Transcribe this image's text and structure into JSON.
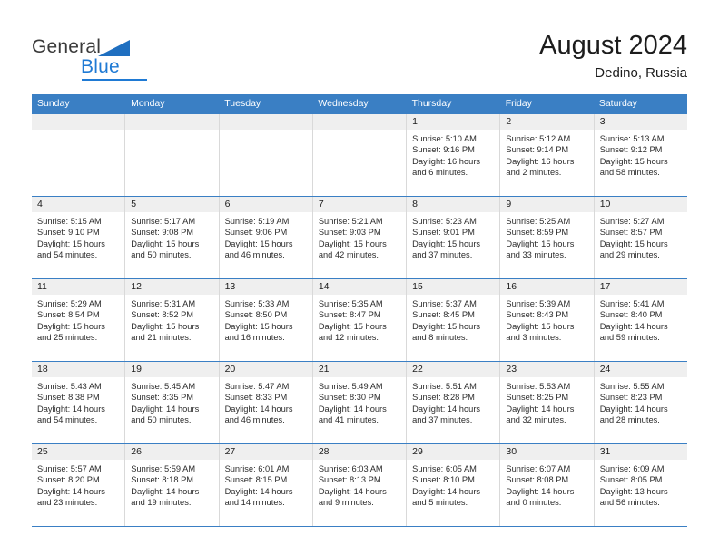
{
  "brand": {
    "name_part1": "General",
    "name_part2": "Blue",
    "triangle_icon": "triangle-icon",
    "colors": {
      "general_text": "#3a3a3a",
      "blue_text": "#1f7ad4",
      "triangle": "#1f6fc0"
    }
  },
  "header": {
    "month_year": "August 2024",
    "location": "Dedino, Russia"
  },
  "calendar": {
    "accent_color": "#3a7fc4",
    "band_color": "#efefef",
    "weekdays": [
      "Sunday",
      "Monday",
      "Tuesday",
      "Wednesday",
      "Thursday",
      "Friday",
      "Saturday"
    ],
    "weeks": [
      [
        {
          "day": "",
          "empty": true,
          "sunrise": "",
          "sunset": "",
          "daylight_line1": "",
          "daylight_line2": ""
        },
        {
          "day": "",
          "empty": true,
          "sunrise": "",
          "sunset": "",
          "daylight_line1": "",
          "daylight_line2": ""
        },
        {
          "day": "",
          "empty": true,
          "sunrise": "",
          "sunset": "",
          "daylight_line1": "",
          "daylight_line2": ""
        },
        {
          "day": "",
          "empty": true,
          "sunrise": "",
          "sunset": "",
          "daylight_line1": "",
          "daylight_line2": ""
        },
        {
          "day": "1",
          "empty": false,
          "sunrise": "Sunrise: 5:10 AM",
          "sunset": "Sunset: 9:16 PM",
          "daylight_line1": "Daylight: 16 hours",
          "daylight_line2": "and 6 minutes."
        },
        {
          "day": "2",
          "empty": false,
          "sunrise": "Sunrise: 5:12 AM",
          "sunset": "Sunset: 9:14 PM",
          "daylight_line1": "Daylight: 16 hours",
          "daylight_line2": "and 2 minutes."
        },
        {
          "day": "3",
          "empty": false,
          "sunrise": "Sunrise: 5:13 AM",
          "sunset": "Sunset: 9:12 PM",
          "daylight_line1": "Daylight: 15 hours",
          "daylight_line2": "and 58 minutes."
        }
      ],
      [
        {
          "day": "4",
          "empty": false,
          "sunrise": "Sunrise: 5:15 AM",
          "sunset": "Sunset: 9:10 PM",
          "daylight_line1": "Daylight: 15 hours",
          "daylight_line2": "and 54 minutes."
        },
        {
          "day": "5",
          "empty": false,
          "sunrise": "Sunrise: 5:17 AM",
          "sunset": "Sunset: 9:08 PM",
          "daylight_line1": "Daylight: 15 hours",
          "daylight_line2": "and 50 minutes."
        },
        {
          "day": "6",
          "empty": false,
          "sunrise": "Sunrise: 5:19 AM",
          "sunset": "Sunset: 9:06 PM",
          "daylight_line1": "Daylight: 15 hours",
          "daylight_line2": "and 46 minutes."
        },
        {
          "day": "7",
          "empty": false,
          "sunrise": "Sunrise: 5:21 AM",
          "sunset": "Sunset: 9:03 PM",
          "daylight_line1": "Daylight: 15 hours",
          "daylight_line2": "and 42 minutes."
        },
        {
          "day": "8",
          "empty": false,
          "sunrise": "Sunrise: 5:23 AM",
          "sunset": "Sunset: 9:01 PM",
          "daylight_line1": "Daylight: 15 hours",
          "daylight_line2": "and 37 minutes."
        },
        {
          "day": "9",
          "empty": false,
          "sunrise": "Sunrise: 5:25 AM",
          "sunset": "Sunset: 8:59 PM",
          "daylight_line1": "Daylight: 15 hours",
          "daylight_line2": "and 33 minutes."
        },
        {
          "day": "10",
          "empty": false,
          "sunrise": "Sunrise: 5:27 AM",
          "sunset": "Sunset: 8:57 PM",
          "daylight_line1": "Daylight: 15 hours",
          "daylight_line2": "and 29 minutes."
        }
      ],
      [
        {
          "day": "11",
          "empty": false,
          "sunrise": "Sunrise: 5:29 AM",
          "sunset": "Sunset: 8:54 PM",
          "daylight_line1": "Daylight: 15 hours",
          "daylight_line2": "and 25 minutes."
        },
        {
          "day": "12",
          "empty": false,
          "sunrise": "Sunrise: 5:31 AM",
          "sunset": "Sunset: 8:52 PM",
          "daylight_line1": "Daylight: 15 hours",
          "daylight_line2": "and 21 minutes."
        },
        {
          "day": "13",
          "empty": false,
          "sunrise": "Sunrise: 5:33 AM",
          "sunset": "Sunset: 8:50 PM",
          "daylight_line1": "Daylight: 15 hours",
          "daylight_line2": "and 16 minutes."
        },
        {
          "day": "14",
          "empty": false,
          "sunrise": "Sunrise: 5:35 AM",
          "sunset": "Sunset: 8:47 PM",
          "daylight_line1": "Daylight: 15 hours",
          "daylight_line2": "and 12 minutes."
        },
        {
          "day": "15",
          "empty": false,
          "sunrise": "Sunrise: 5:37 AM",
          "sunset": "Sunset: 8:45 PM",
          "daylight_line1": "Daylight: 15 hours",
          "daylight_line2": "and 8 minutes."
        },
        {
          "day": "16",
          "empty": false,
          "sunrise": "Sunrise: 5:39 AM",
          "sunset": "Sunset: 8:43 PM",
          "daylight_line1": "Daylight: 15 hours",
          "daylight_line2": "and 3 minutes."
        },
        {
          "day": "17",
          "empty": false,
          "sunrise": "Sunrise: 5:41 AM",
          "sunset": "Sunset: 8:40 PM",
          "daylight_line1": "Daylight: 14 hours",
          "daylight_line2": "and 59 minutes."
        }
      ],
      [
        {
          "day": "18",
          "empty": false,
          "sunrise": "Sunrise: 5:43 AM",
          "sunset": "Sunset: 8:38 PM",
          "daylight_line1": "Daylight: 14 hours",
          "daylight_line2": "and 54 minutes."
        },
        {
          "day": "19",
          "empty": false,
          "sunrise": "Sunrise: 5:45 AM",
          "sunset": "Sunset: 8:35 PM",
          "daylight_line1": "Daylight: 14 hours",
          "daylight_line2": "and 50 minutes."
        },
        {
          "day": "20",
          "empty": false,
          "sunrise": "Sunrise: 5:47 AM",
          "sunset": "Sunset: 8:33 PM",
          "daylight_line1": "Daylight: 14 hours",
          "daylight_line2": "and 46 minutes."
        },
        {
          "day": "21",
          "empty": false,
          "sunrise": "Sunrise: 5:49 AM",
          "sunset": "Sunset: 8:30 PM",
          "daylight_line1": "Daylight: 14 hours",
          "daylight_line2": "and 41 minutes."
        },
        {
          "day": "22",
          "empty": false,
          "sunrise": "Sunrise: 5:51 AM",
          "sunset": "Sunset: 8:28 PM",
          "daylight_line1": "Daylight: 14 hours",
          "daylight_line2": "and 37 minutes."
        },
        {
          "day": "23",
          "empty": false,
          "sunrise": "Sunrise: 5:53 AM",
          "sunset": "Sunset: 8:25 PM",
          "daylight_line1": "Daylight: 14 hours",
          "daylight_line2": "and 32 minutes."
        },
        {
          "day": "24",
          "empty": false,
          "sunrise": "Sunrise: 5:55 AM",
          "sunset": "Sunset: 8:23 PM",
          "daylight_line1": "Daylight: 14 hours",
          "daylight_line2": "and 28 minutes."
        }
      ],
      [
        {
          "day": "25",
          "empty": false,
          "sunrise": "Sunrise: 5:57 AM",
          "sunset": "Sunset: 8:20 PM",
          "daylight_line1": "Daylight: 14 hours",
          "daylight_line2": "and 23 minutes."
        },
        {
          "day": "26",
          "empty": false,
          "sunrise": "Sunrise: 5:59 AM",
          "sunset": "Sunset: 8:18 PM",
          "daylight_line1": "Daylight: 14 hours",
          "daylight_line2": "and 19 minutes."
        },
        {
          "day": "27",
          "empty": false,
          "sunrise": "Sunrise: 6:01 AM",
          "sunset": "Sunset: 8:15 PM",
          "daylight_line1": "Daylight: 14 hours",
          "daylight_line2": "and 14 minutes."
        },
        {
          "day": "28",
          "empty": false,
          "sunrise": "Sunrise: 6:03 AM",
          "sunset": "Sunset: 8:13 PM",
          "daylight_line1": "Daylight: 14 hours",
          "daylight_line2": "and 9 minutes."
        },
        {
          "day": "29",
          "empty": false,
          "sunrise": "Sunrise: 6:05 AM",
          "sunset": "Sunset: 8:10 PM",
          "daylight_line1": "Daylight: 14 hours",
          "daylight_line2": "and 5 minutes."
        },
        {
          "day": "30",
          "empty": false,
          "sunrise": "Sunrise: 6:07 AM",
          "sunset": "Sunset: 8:08 PM",
          "daylight_line1": "Daylight: 14 hours",
          "daylight_line2": "and 0 minutes."
        },
        {
          "day": "31",
          "empty": false,
          "sunrise": "Sunrise: 6:09 AM",
          "sunset": "Sunset: 8:05 PM",
          "daylight_line1": "Daylight: 13 hours",
          "daylight_line2": "and 56 minutes."
        }
      ]
    ]
  }
}
